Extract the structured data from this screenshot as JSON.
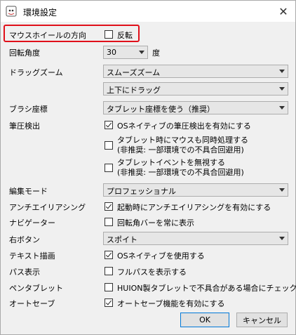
{
  "window": {
    "title": "環境設定"
  },
  "rows": {
    "mouse_wheel": {
      "label": "マウスホイールの方向",
      "checkbox_label": "反転",
      "checked": false
    },
    "rotation_angle": {
      "label": "回転角度",
      "value": "30",
      "unit": "度"
    },
    "drag_zoom": {
      "label": "ドラッグズーム",
      "value": "スムーズズーム",
      "value2": "上下にドラッグ"
    },
    "brush_coords": {
      "label": "ブラシ座標",
      "value": "タブレット座標を使う（推奨）"
    },
    "pressure": {
      "label": "筆圧検出",
      "opt1": "OSネイティブの筆圧検出を有効にする",
      "opt2_line1": "タブレット時にマウスも同時処理する",
      "opt2_line2": "(非推奨: 一部環境での不具合回避用)",
      "opt3_line1": "タブレットイベントを無視する",
      "opt3_line2": "(非推奨: 一部環境での不具合回避用)"
    },
    "edit_mode": {
      "label": "編集モード",
      "value": "プロフェッショナル"
    },
    "antialias": {
      "label": "アンチエイリアシング",
      "checkbox_label": "起動時にアンチエイリアシングを有効にする"
    },
    "navigator": {
      "label": "ナビゲーター",
      "checkbox_label": "回転角バーを常に表示"
    },
    "right_button": {
      "label": "右ボタン",
      "value": "スポイト"
    },
    "text_render": {
      "label": "テキスト描画",
      "checkbox_label": "OSネイティブを使用する"
    },
    "path_display": {
      "label": "パス表示",
      "checkbox_label": "フルパスを表示する"
    },
    "pen_tablet": {
      "label": "ペンタブレット",
      "checkbox_label": "HUION製タブレットで不具合がある場合にチェック"
    },
    "autosave": {
      "label": "オートセーブ",
      "checkbox_label": "オートセーブ機能を有効にする"
    }
  },
  "buttons": {
    "ok": "OK",
    "cancel": "キャンセル"
  },
  "colors": {
    "highlight": "#e0101a",
    "default_button_border": "#0078d7"
  }
}
